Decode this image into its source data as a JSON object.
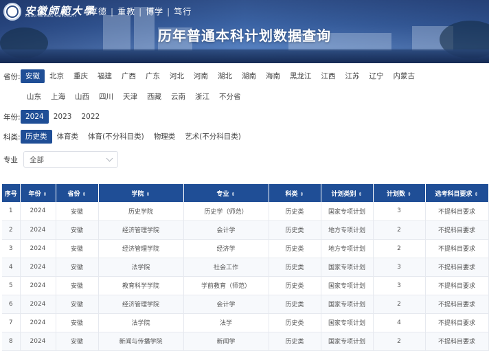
{
  "header": {
    "logo_name": "安徽師範大學",
    "logo_en": "ANHUI NORMAL UNIVERSITY",
    "motto": [
      "厚德",
      "重教",
      "博学",
      "笃行"
    ],
    "title": "历年普通本科计划数据查询"
  },
  "filters": {
    "province_label": "省份:",
    "provinces_row1": [
      "安徽",
      "北京",
      "重庆",
      "福建",
      "广西",
      "广东",
      "河北",
      "河南",
      "湖北",
      "湖南",
      "海南",
      "黑龙江",
      "江西",
      "江苏",
      "辽宁",
      "内蒙古"
    ],
    "provinces_row2": [
      "山东",
      "上海",
      "山西",
      "四川",
      "天津",
      "西藏",
      "云南",
      "浙江",
      "不分省"
    ],
    "province_selected": "安徽",
    "year_label": "年份:",
    "years": [
      "2024",
      "2023",
      "2022"
    ],
    "year_selected": "2024",
    "category_label": "科类:",
    "categories": [
      "历史类",
      "体育类",
      "体育(不分科目类)",
      "物理类",
      "艺术(不分科目类)"
    ],
    "category_selected": "历史类",
    "major_label": "专业",
    "major_value": "全部"
  },
  "table": {
    "columns": [
      "序号",
      "年份",
      "省份",
      "学院",
      "专业",
      "科类",
      "计划类别",
      "计划数",
      "选考科目要求"
    ],
    "sortable": [
      false,
      true,
      true,
      true,
      true,
      true,
      true,
      true,
      true
    ],
    "rows": [
      [
        "1",
        "2024",
        "安徽",
        "历史学院",
        "历史学（师范）",
        "历史类",
        "国家专项计划",
        "3",
        "不提科目要求"
      ],
      [
        "2",
        "2024",
        "安徽",
        "经济管理学院",
        "会计学",
        "历史类",
        "地方专项计划",
        "2",
        "不提科目要求"
      ],
      [
        "3",
        "2024",
        "安徽",
        "经济管理学院",
        "经济学",
        "历史类",
        "地方专项计划",
        "2",
        "不提科目要求"
      ],
      [
        "4",
        "2024",
        "安徽",
        "法学院",
        "社会工作",
        "历史类",
        "国家专项计划",
        "3",
        "不提科目要求"
      ],
      [
        "5",
        "2024",
        "安徽",
        "教育科学学院",
        "学前教育（师范）",
        "历史类",
        "国家专项计划",
        "3",
        "不提科目要求"
      ],
      [
        "6",
        "2024",
        "安徽",
        "经济管理学院",
        "会计学",
        "历史类",
        "国家专项计划",
        "2",
        "不提科目要求"
      ],
      [
        "7",
        "2024",
        "安徽",
        "法学院",
        "法学",
        "历史类",
        "国家专项计划",
        "4",
        "不提科目要求"
      ],
      [
        "8",
        "2024",
        "安徽",
        "新闻与传播学院",
        "新闻学",
        "历史类",
        "国家专项计划",
        "2",
        "不提科目要求"
      ]
    ]
  },
  "colors": {
    "accent": "#1f4e96"
  }
}
